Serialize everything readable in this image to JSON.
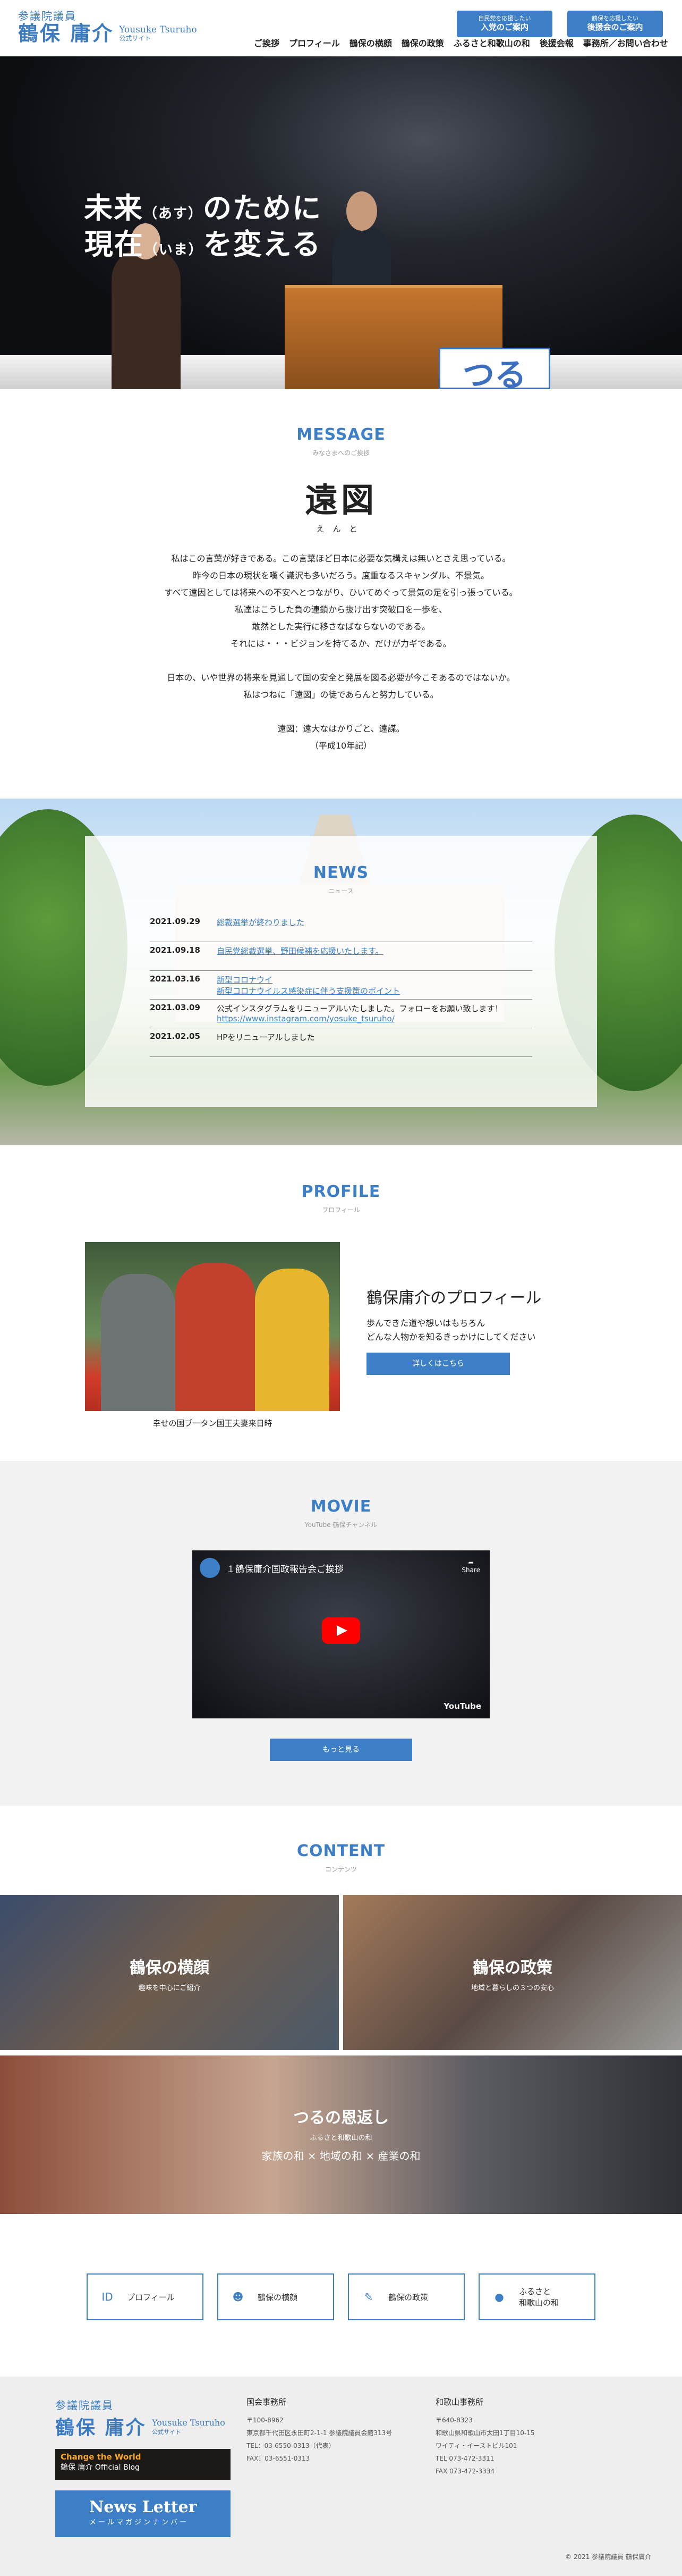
{
  "header": {
    "logo_line1": "参議院議員",
    "logo_name": "鶴保 庸介",
    "logo_en": "Yousuke Tsuruho",
    "logo_site": "公式サイト",
    "cta1": {
      "small": "自民党を応援したい",
      "main": "入党のご案内"
    },
    "cta2": {
      "small": "鶴保を応援したい",
      "main": "後援会のご案内"
    },
    "nav": [
      "ご挨拶",
      "プロフィール",
      "鶴保の横顔",
      "鶴保の政策",
      "ふるさと和歌山の和",
      "後援会報",
      "事務所／お問い合わせ"
    ]
  },
  "hero": {
    "line1_a": "未来",
    "line1_ruby": "（あす）",
    "line1_b": "のために",
    "line2_a": "現在",
    "line2_ruby": "（いま）",
    "line2_b": "を変える",
    "poster_text": "つる"
  },
  "message": {
    "title": "MESSAGE",
    "subtitle": "みなさまへのご挨拶",
    "callig": "遠図",
    "ruby": "えんと",
    "para1": [
      "私はこの言葉が好きである。この言葉ほど日本に必要な気構えは無いとさえ思っている。",
      "昨今の日本の現状を嘆く識沢も多いだろう。度重なるスキャンダル、不景気。",
      "すべて遠因としては将来への不安へとつながり、ひいてめぐって景気の足を引っ張っている。",
      "私達はこうした負の連鎖から抜け出す突破口を一歩を、",
      "敢然とした実行に移さなばならないのである。",
      "それには・・・ビジョンを持てるか、だけが力ギである。"
    ],
    "para2": [
      "日本の、いや世界の将来を見通して国の安全と発展を図る必要が今こそあるのではないか。",
      "私はつねに「遠図」の徒であらんと努力している。"
    ],
    "para3": [
      "遠図：遠大なはかりごと、遠謀。",
      "（平成10年記）"
    ]
  },
  "news": {
    "title": "NEWS",
    "subtitle": "ニュース",
    "items": [
      {
        "date": "2021.09.29",
        "title": "総裁選挙が終わりました",
        "title2": ""
      },
      {
        "date": "2021.09.18",
        "title": "自民党総裁選挙、野田候補を応援いたします。",
        "title2": ""
      },
      {
        "date": "2021.03.16",
        "title": "新型コロナウイ",
        "title2": "新型コロナウイルス感染症に伴う支援策のポイント"
      },
      {
        "date": "2021.03.09",
        "title": "公式インスタグラムをリニューアルいたしました。フォローをお願い致します！",
        "title2": "https://www.instagram.com/yosuke_tsuruho/"
      },
      {
        "date": "2021.02.05",
        "title": "HPをリニューアルしました",
        "title2": ""
      }
    ]
  },
  "profile": {
    "title": "PROFILE",
    "subtitle": "プロフィール",
    "caption": "幸せの国ブータン国王夫妻来日時",
    "heading": "鶴保庸介のプロフィール",
    "desc1": "歩んできた道や想いはもちろん",
    "desc2": "どんな人物かを知るきっかけにしてください",
    "button": "詳しくはこちら"
  },
  "movie": {
    "title": "MOVIE",
    "subtitle": "YouTube 鶴保チャンネル",
    "video_title": "１鶴保庸介国政報告会ご挨拶",
    "share": "Share",
    "yt": "YouTube",
    "button": "もっと見る"
  },
  "content": {
    "title": "CONTENT",
    "subtitle": "コンテンツ",
    "tiles": [
      {
        "title": "鶴保の横顔",
        "desc": "趣味を中心にご紹介"
      },
      {
        "title": "鶴保の政策",
        "desc": "地域と暮らしの３つの安心"
      },
      {
        "title": "つるの恩返し",
        "desc": "ふるさと和歌山の和",
        "desc2": "家族の和 × 地域の和 × 産業の和"
      }
    ]
  },
  "bottom_nav": [
    {
      "icon": "ID",
      "label": "プロフィール",
      "label2": ""
    },
    {
      "icon": "☻",
      "label": "鶴保の横顔",
      "label2": ""
    },
    {
      "icon": "✎",
      "label": "鶴保の政策",
      "label2": ""
    },
    {
      "icon": "●",
      "label": "ふるさと",
      "label2": "和歌山の和"
    }
  ],
  "footer": {
    "logo_line1": "参議院議員",
    "logo_name": "鶴保 庸介",
    "logo_en": "Yousuke Tsuruho",
    "logo_site": "公式サイト",
    "blog_line1": "Change the World",
    "blog_line2": "鶴保 庸介 Official Blog",
    "nl_main": "News Letter",
    "nl_sub": "メールマガジンナンバー",
    "office1": {
      "name": "国会事務所",
      "lines": [
        "〒100-8962",
        "東京都千代田区永田町2-1-1 参議院議員会館313号",
        "TEL：03-6550-0313（代表）",
        "FAX：03-6551-0313"
      ]
    },
    "office2": {
      "name": "和歌山事務所",
      "lines": [
        "〒640-8323",
        "和歌山県和歌山市太田1丁目10-15",
        "ワイティ・イーストビル101",
        "TEL 073-472-3311",
        "FAX 073-472-3334"
      ]
    },
    "copyright": "© 2021 参議院議員 鶴保庸介"
  }
}
